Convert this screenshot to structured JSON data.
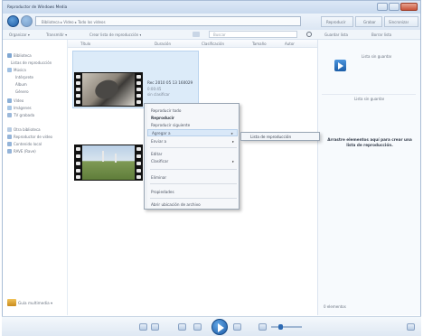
{
  "window": {
    "title": "Reproductor de Windows Media"
  },
  "address": {
    "path": "Biblioteca  ▸  Vídeo  ▸  Todo los vídeos",
    "search_placeholder": "Buscar"
  },
  "tabs": [
    "Reproducir",
    "Grabar",
    "Sincronizar"
  ],
  "toolbar": {
    "organize": "Organizar ▾",
    "stream": "Transmitir ▾",
    "create_list": "Crear lista de reproducción ▾",
    "save_list": "Guardar lista",
    "clear": "Borrar lista"
  },
  "nav": {
    "items": [
      "Biblioteca",
      "Listas de reproducción",
      "Música",
      "Intérprete",
      "Álbum",
      "Género",
      "Vídeo",
      "Imágenes",
      "TV grabada",
      "Otra biblioteca",
      "Reproductor de vídeo",
      "Contenido local",
      "RAVE (Rave)"
    ],
    "media_guide": "Guía multimedia ▾"
  },
  "columns": [
    "Título",
    "Duración",
    "Clasificación",
    "Tamaño",
    "Autor"
  ],
  "videos": [
    {
      "title": "Rec 2010 05 13 160029",
      "meta1": "0:00:45",
      "meta2": "sin clasificar"
    }
  ],
  "context_menu": {
    "items": [
      "Reproducir todo",
      "Reproducir",
      "Reproducir siguiente",
      "Agregar a",
      "Enviar a",
      "Editar",
      "Clasificar",
      "Eliminar",
      "Propiedades",
      "Abrir ubicación de archivo"
    ],
    "submenu_item": "Lista de reproducción"
  },
  "right_panel": {
    "save_list": "Lista sin guardar",
    "untitled": "Lista sin guardar",
    "drag_hint": "Arrastre elementos aquí para crear una lista de reproducción.",
    "items_count": "0 elementos"
  },
  "colors": {
    "accent": "#1f5da6",
    "selection": "#dcebf9",
    "menu_highlight": "#d9e8f8"
  }
}
